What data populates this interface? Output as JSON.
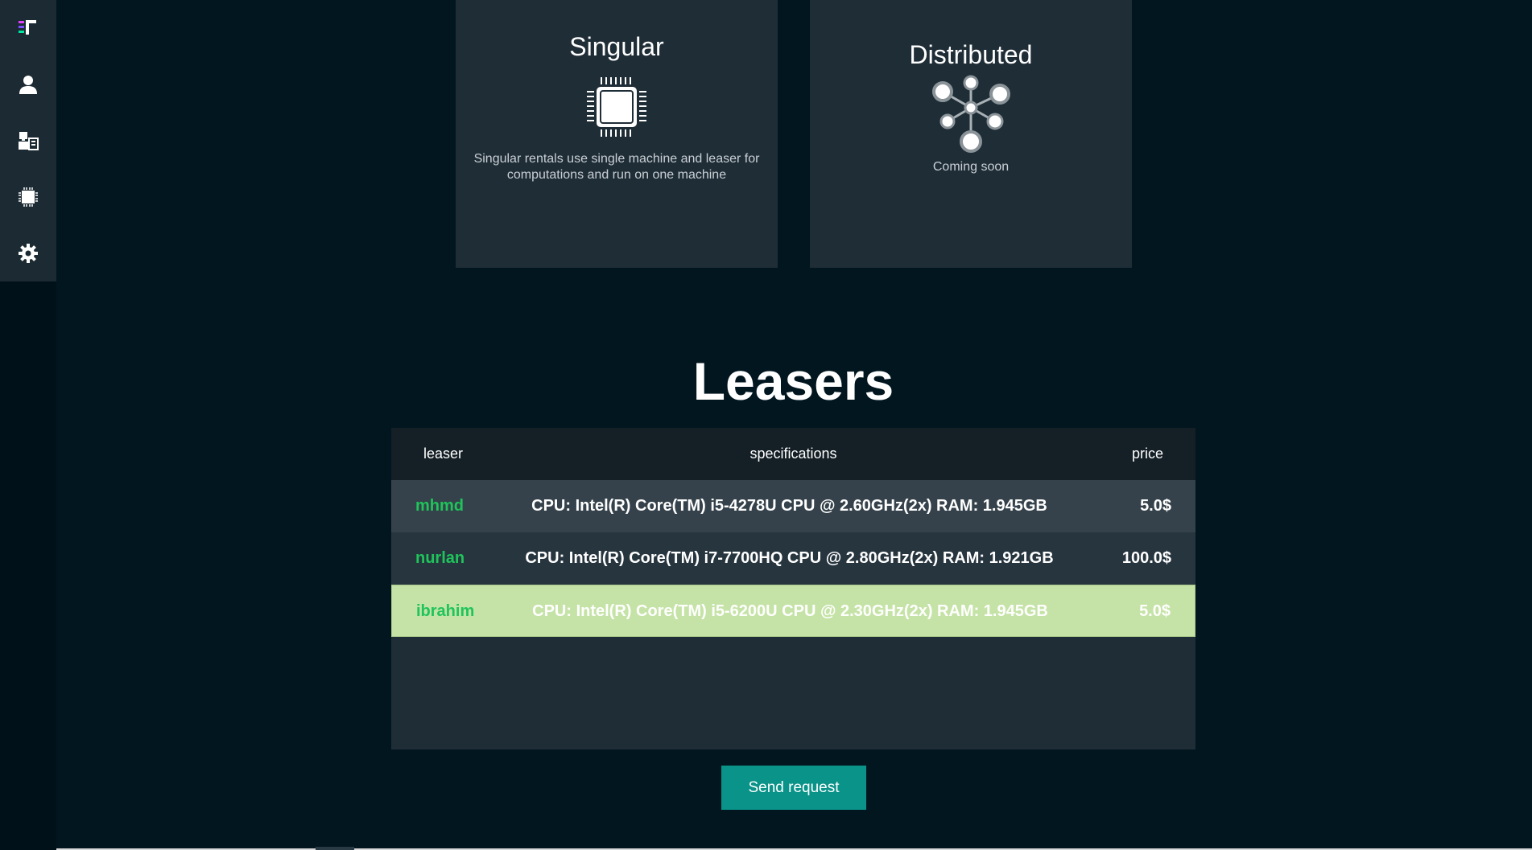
{
  "sidebar": {
    "items": [
      {
        "icon": "logo-icon"
      },
      {
        "icon": "user-icon"
      },
      {
        "icon": "machines-icon"
      },
      {
        "icon": "chip-icon"
      },
      {
        "icon": "gear-icon"
      }
    ]
  },
  "modes": {
    "singular": {
      "title": "Singular",
      "description": "Singular rentals use single machine and leaser for computations and run on one machine",
      "icon": "chip-icon"
    },
    "distributed": {
      "title": "Distributed",
      "description": "Coming soon",
      "icon": "network-icon"
    }
  },
  "leasers": {
    "title": "Leasers",
    "columns": {
      "leaser": "leaser",
      "specifications": "specifications",
      "price": "price"
    },
    "rows": [
      {
        "leaser": "mhmd",
        "specifications": "CPU: Intel(R) Core(TM) i5-4278U CPU @ 2.60GHz(2x) RAM: 1.945GB",
        "price": "5.0$"
      },
      {
        "leaser": "nurlan",
        "specifications": "CPU: Intel(R) Core(TM) i7-7700HQ CPU @ 2.80GHz(2x) RAM: 1.921GB",
        "price": "100.0$"
      },
      {
        "leaser": "ibrahim",
        "specifications": "CPU: Intel(R) Core(TM) i5-6200U CPU @ 2.30GHz(2x) RAM: 1.945GB",
        "price": "5.0$",
        "selected": true
      }
    ]
  },
  "actions": {
    "send_request_label": "Send request"
  },
  "colors": {
    "background": "#021620",
    "card": "#1f2d37",
    "leaser_name": "#1fc45a",
    "selected_row": "#c5e3a6",
    "button": "#0a9389"
  }
}
